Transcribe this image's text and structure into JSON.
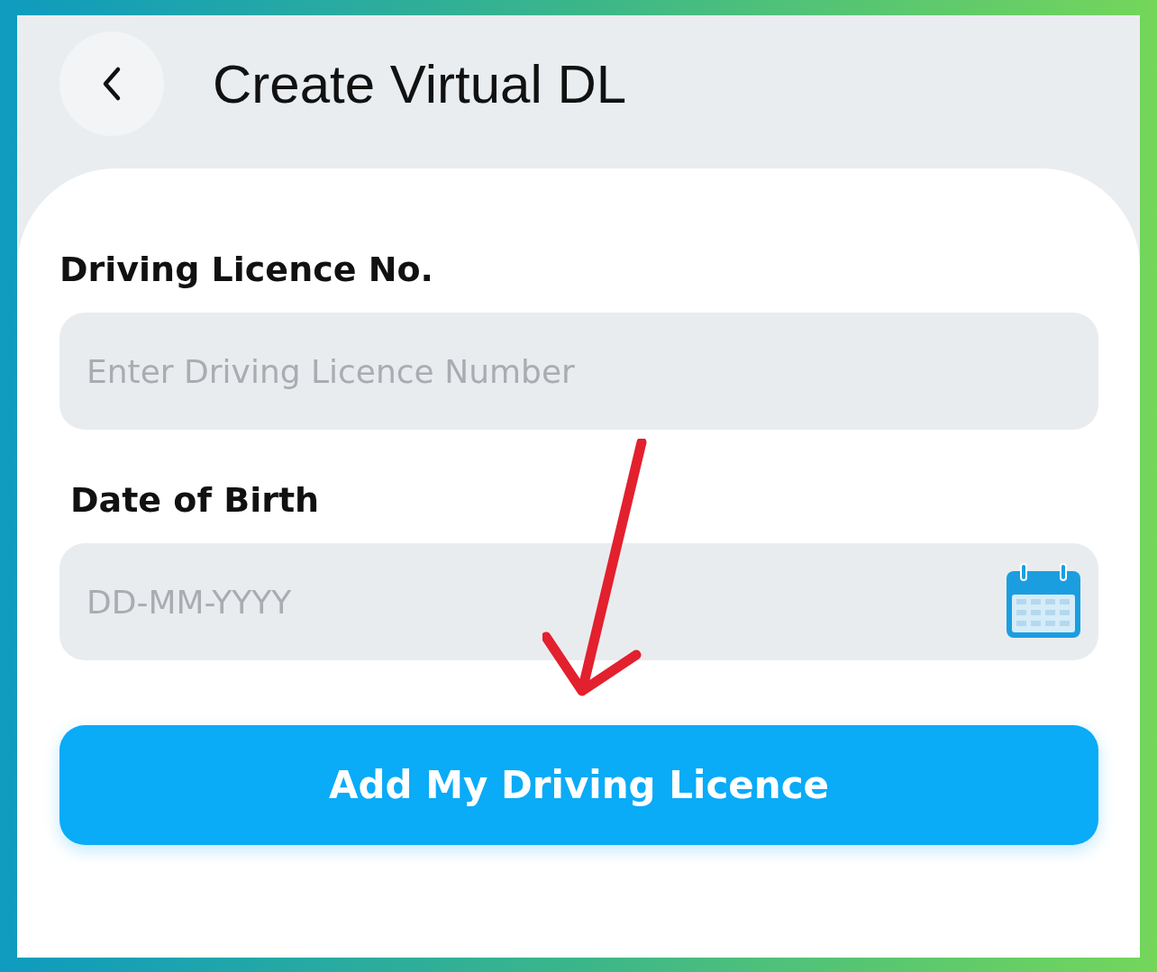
{
  "header": {
    "title": "Create Virtual DL"
  },
  "form": {
    "fields": [
      {
        "kind": "text",
        "label": "Driving Licence No.",
        "placeholder": "Enter Driving Licence Number"
      },
      {
        "kind": "date",
        "label": "Date of Birth",
        "placeholder": "DD-MM-YYYY"
      }
    ],
    "submit_button": "Add My Driving Licence"
  }
}
